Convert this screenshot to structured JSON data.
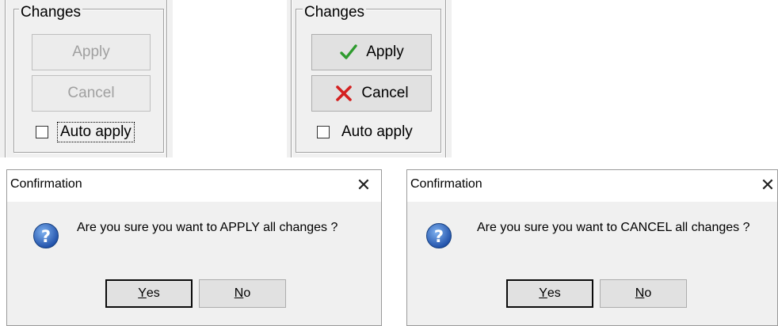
{
  "panel_disabled": {
    "legend": "Changes",
    "apply_label": "Apply",
    "cancel_label": "Cancel",
    "auto_apply_label": "Auto apply",
    "auto_apply_checked": false
  },
  "panel_enabled": {
    "legend": "Changes",
    "apply_label": "Apply",
    "cancel_label": "Cancel",
    "auto_apply_label": "Auto apply",
    "auto_apply_checked": false
  },
  "dialog_apply": {
    "title": "Confirmation",
    "close_glyph": "✕",
    "message": "Are you sure you want to APPLY all changes ?",
    "yes_mnemonic": "Y",
    "yes_rest": "es",
    "no_mnemonic": "N",
    "no_rest": "o"
  },
  "dialog_cancel": {
    "title": "Confirmation",
    "close_glyph": "✕",
    "message": "Are you sure you want to CANCEL all changes ?",
    "yes_mnemonic": "Y",
    "yes_rest": "es",
    "no_mnemonic": "N",
    "no_rest": "o"
  },
  "colors": {
    "apply_icon": "#2e9b2e",
    "cancel_icon": "#d42020",
    "question_icon": "#2a5fb8"
  },
  "icons": {
    "apply": "checkmark-icon",
    "cancel": "red-x-icon",
    "question": "question-icon",
    "close": "close-icon"
  }
}
